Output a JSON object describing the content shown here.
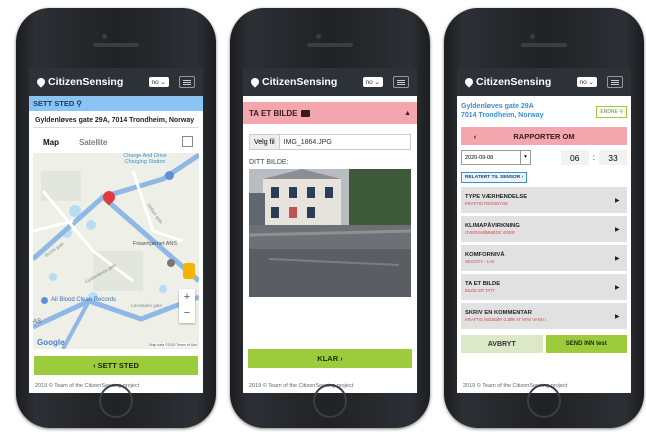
{
  "app": {
    "brand": "CitizenSensing",
    "language": "no",
    "footer": "2019 © Team of the CitizenSensing project"
  },
  "screen1": {
    "section_title": "SETT STED",
    "address_value": "Gyldenløves gate 29A, 7014 Trondheim, Norway",
    "map_tabs": [
      "Map",
      "Satellite"
    ],
    "map_labels": {
      "poi1": "Charge And Drive Charging Station",
      "poi2": "Frisørhjørnet ANS",
      "poi3": "All Blood Clean Records",
      "street1": "Buchs gate",
      "street2": "Gyldenløves gate",
      "street3": "Selbus gate",
      "street4": "Løvstaden gate",
      "logo": "Google",
      "attribution": "Map data ©2020   Terms of Use",
      "partial": "AS"
    },
    "zoom_in": "+",
    "zoom_out": "−",
    "action_button": "‹ SETT STED"
  },
  "screen2": {
    "section_title": "TA ET BILDE",
    "file_button": "Velg fil",
    "file_name": "IMG_1864.JPG",
    "photo_label": "DITT BILDE:",
    "action_button": "KLAR ›"
  },
  "screen3": {
    "location_line1": "Gyldenløves gate 29A",
    "location_line2": "7014 Trondheim, Norway",
    "edit_button": "ENDRE",
    "report_prev": "‹",
    "report_title": "RAPPORTER OM",
    "date_value": "2020-09-08",
    "hour": "06",
    "minute": "33",
    "related_button": "RELATERT TIL SENSOR ›",
    "sections": [
      {
        "title": "TYPE VÆRHENDELSE",
        "value": "KRAFTIG REGNBYGE"
      },
      {
        "title": "KLIMAPÅVIRKNING",
        "value": "OVERSVØMMEDE VEIER"
      },
      {
        "title": "KOMFORNIVÅ",
        "value": "NEGATIV - LAV"
      },
      {
        "title": "TA ET BILDE",
        "value": "BILDE ER TATT"
      },
      {
        "title": "SKRIV EN KOMMENTAR",
        "value": "KRAFTIG NEDBØR GJØR AT MYE VANN I"
      }
    ],
    "cancel_button": "AVBRYT",
    "submit_button": "SEND INN test"
  },
  "colors": {
    "app_bar": "#2d3238",
    "accent_green": "#9ccb3b",
    "section_blue": "#89c4f4",
    "section_pink": "#f3a6ad",
    "link_blue": "#3a8fd8"
  }
}
